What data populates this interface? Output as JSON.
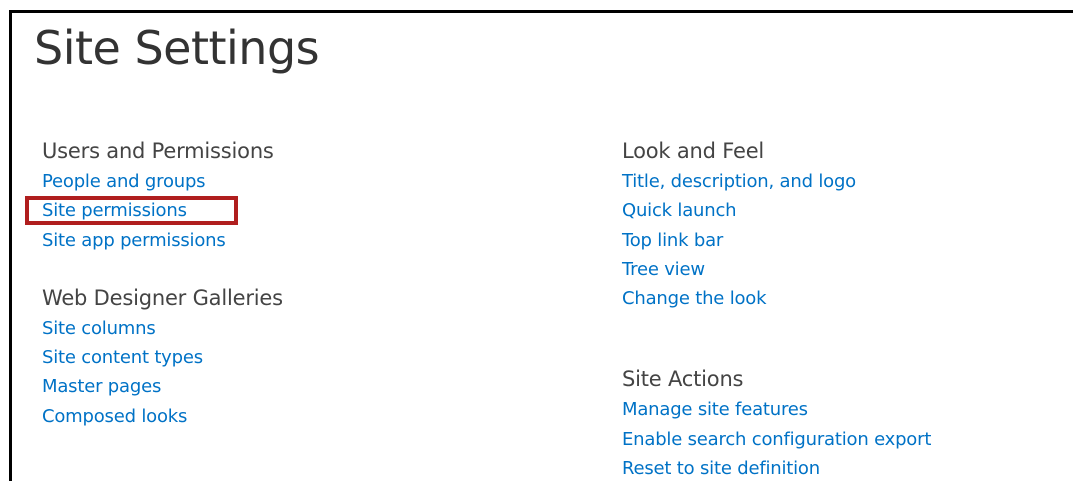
{
  "page": {
    "title": "Site Settings"
  },
  "left_column": {
    "sections": [
      {
        "heading": "Users and Permissions",
        "links": [
          "People and groups",
          "Site permissions",
          "Site app permissions"
        ]
      },
      {
        "heading": "Web Designer Galleries",
        "links": [
          "Site columns",
          "Site content types",
          "Master pages",
          "Composed looks"
        ]
      }
    ]
  },
  "right_column": {
    "sections": [
      {
        "heading": "Look and Feel",
        "links": [
          "Title, description, and logo",
          "Quick launch",
          "Top link bar",
          "Tree view",
          "Change the look"
        ]
      },
      {
        "heading": "Site Actions",
        "links": [
          "Manage site features",
          "Enable search configuration export",
          "Reset to site definition"
        ]
      }
    ]
  },
  "highlight": {
    "target": "Site permissions",
    "color": "#b01e1e"
  },
  "colors": {
    "link": "#0072c6",
    "heading": "#444444",
    "title": "#333333",
    "frame": "#000000"
  }
}
